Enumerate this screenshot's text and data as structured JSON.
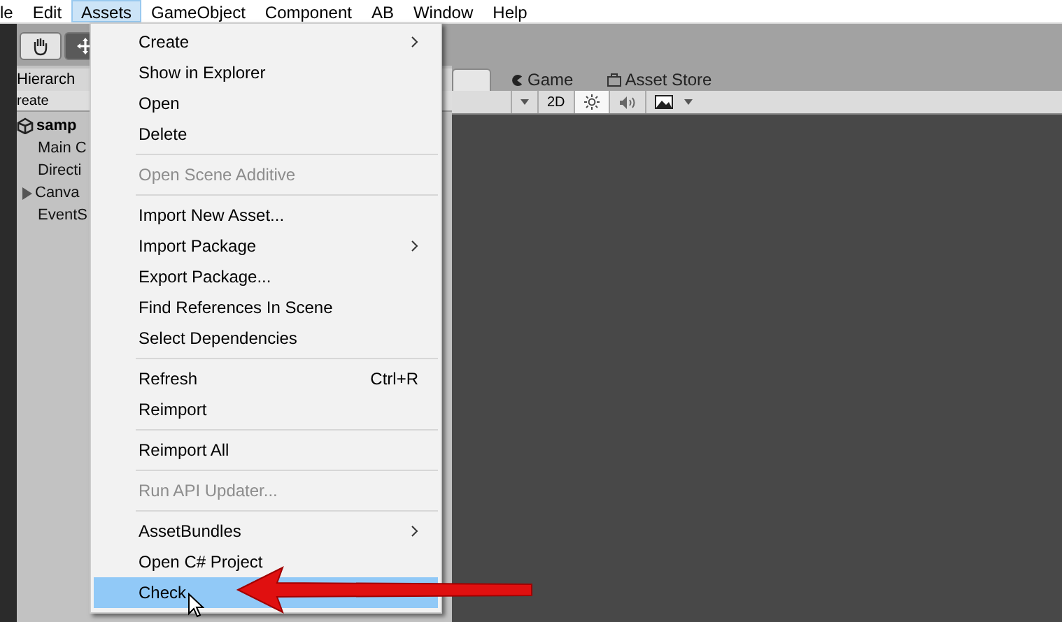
{
  "menubar": [
    {
      "label": "le",
      "selected": false
    },
    {
      "label": "Edit",
      "selected": false
    },
    {
      "label": "Assets",
      "selected": true
    },
    {
      "label": "GameObject",
      "selected": false
    },
    {
      "label": "Component",
      "selected": false
    },
    {
      "label": "AB",
      "selected": false
    },
    {
      "label": "Window",
      "selected": false
    },
    {
      "label": "Help",
      "selected": false
    }
  ],
  "hierarchy": {
    "title": "Hierarch",
    "create": "reate",
    "scene": "samp",
    "items": [
      {
        "label": "Main C",
        "expandable": false
      },
      {
        "label": "Directi",
        "expandable": false
      },
      {
        "label": "Canva",
        "expandable": true
      },
      {
        "label": "EventS",
        "expandable": false
      }
    ]
  },
  "scene_tabs": [
    {
      "kind": "plain",
      "selected": true
    },
    {
      "label": "Game",
      "kind": "game",
      "selected": false
    },
    {
      "label": "Asset Store",
      "kind": "store",
      "selected": false
    }
  ],
  "scene_toolbar": {
    "mode": "2D",
    "lighting_on": true,
    "audio_on": false
  },
  "menu": [
    {
      "kind": "item",
      "label": "Create",
      "submenu": true,
      "disabled": false,
      "selected": false
    },
    {
      "kind": "item",
      "label": "Show in Explorer",
      "submenu": false,
      "disabled": false,
      "selected": false
    },
    {
      "kind": "item",
      "label": "Open",
      "submenu": false,
      "disabled": false,
      "selected": false
    },
    {
      "kind": "item",
      "label": "Delete",
      "submenu": false,
      "disabled": false,
      "selected": false
    },
    {
      "kind": "separator"
    },
    {
      "kind": "item",
      "label": "Open Scene Additive",
      "submenu": false,
      "disabled": true,
      "selected": false
    },
    {
      "kind": "separator"
    },
    {
      "kind": "item",
      "label": "Import New Asset...",
      "submenu": false,
      "disabled": false,
      "selected": false
    },
    {
      "kind": "item",
      "label": "Import Package",
      "submenu": true,
      "disabled": false,
      "selected": false
    },
    {
      "kind": "item",
      "label": "Export Package...",
      "submenu": false,
      "disabled": false,
      "selected": false
    },
    {
      "kind": "item",
      "label": "Find References In Scene",
      "submenu": false,
      "disabled": false,
      "selected": false
    },
    {
      "kind": "item",
      "label": "Select Dependencies",
      "submenu": false,
      "disabled": false,
      "selected": false
    },
    {
      "kind": "separator"
    },
    {
      "kind": "item",
      "label": "Refresh",
      "shortcut": "Ctrl+R",
      "submenu": false,
      "disabled": false,
      "selected": false
    },
    {
      "kind": "item",
      "label": "Reimport",
      "submenu": false,
      "disabled": false,
      "selected": false
    },
    {
      "kind": "separator"
    },
    {
      "kind": "item",
      "label": "Reimport All",
      "submenu": false,
      "disabled": false,
      "selected": false
    },
    {
      "kind": "separator"
    },
    {
      "kind": "item",
      "label": "Run API Updater...",
      "submenu": false,
      "disabled": true,
      "selected": false
    },
    {
      "kind": "separator"
    },
    {
      "kind": "item",
      "label": "AssetBundles",
      "submenu": true,
      "disabled": false,
      "selected": false
    },
    {
      "kind": "item",
      "label": "Open C# Project",
      "submenu": false,
      "disabled": false,
      "selected": false
    },
    {
      "kind": "item",
      "label": "Check",
      "submenu": false,
      "disabled": false,
      "selected": true
    }
  ]
}
